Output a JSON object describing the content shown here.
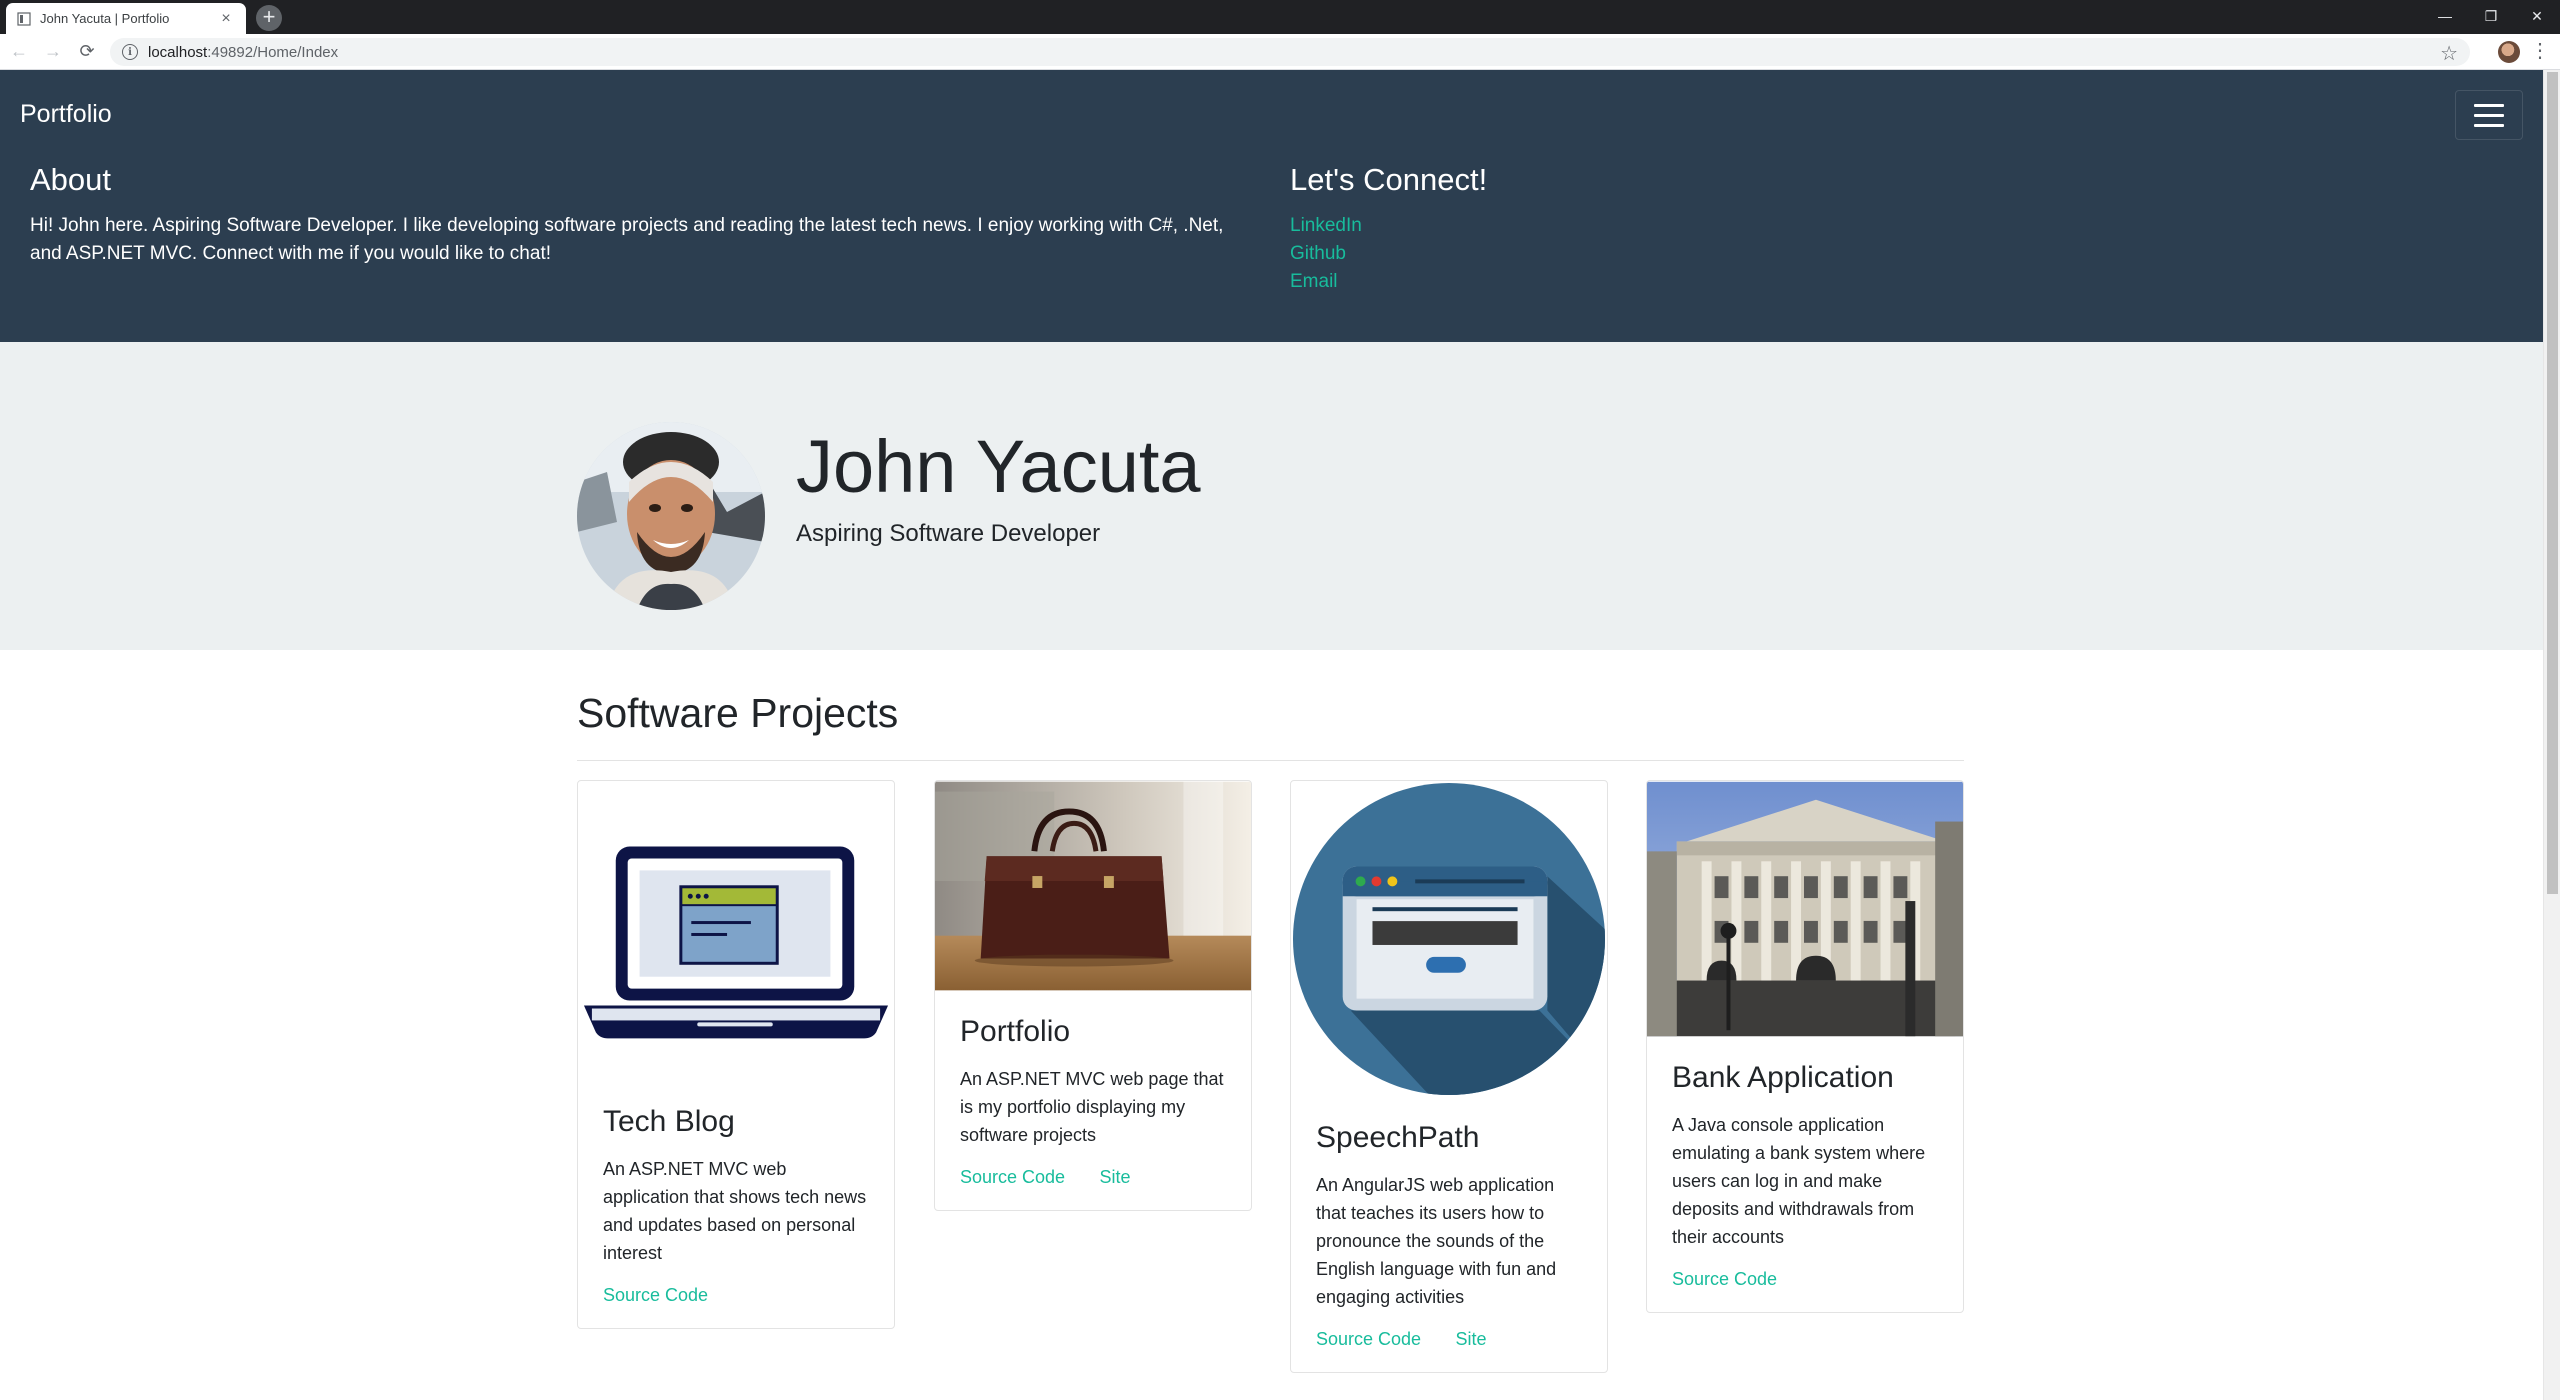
{
  "browser": {
    "tab_title": "John Yacuta | Portfolio",
    "url_host": "localhost",
    "url_rest": ":49892/Home/Index"
  },
  "navbar": {
    "brand": "Portfolio"
  },
  "about": {
    "heading": "About",
    "text": "Hi! John here. Aspiring Software Developer. I like developing software projects and reading the latest tech news. I enjoy working with C#, .Net, and ASP.NET MVC. Connect with me if you would like to chat!"
  },
  "connect": {
    "heading": "Let's Connect!",
    "links": [
      "LinkedIn",
      "Github",
      "Email"
    ]
  },
  "hero": {
    "name": "John Yacuta",
    "subtitle": "Aspiring Software Developer"
  },
  "projects": {
    "heading": "Software Projects",
    "items": [
      {
        "title": "Tech Blog",
        "description": "An ASP.NET MVC web application that shows tech news and updates based on personal interest",
        "links": [
          "Source Code"
        ]
      },
      {
        "title": "Portfolio",
        "description": "An ASP.NET MVC web page that is my portfolio displaying my software projects",
        "links": [
          "Source Code",
          "Site"
        ]
      },
      {
        "title": "SpeechPath",
        "description": "An AngularJS web application that teaches its users how to pronounce the sounds of the English language with fun and engaging activities",
        "links": [
          "Source Code",
          "Site"
        ]
      },
      {
        "title": "Bank Application",
        "description": "A Java console application emulating a bank system where users can log in and make deposits and withdrawals from their accounts",
        "links": [
          "Source Code"
        ]
      }
    ]
  },
  "colors": {
    "navbar_bg": "#2c3e50",
    "accent": "#18bc9c",
    "jumbotron_bg": "#ecf0f1"
  },
  "icons": [
    "page-favicon",
    "new-tab-icon",
    "minimize-icon",
    "restore-icon",
    "close-icon",
    "back-icon",
    "forward-icon",
    "reload-icon",
    "info-icon",
    "bookmark-star-icon",
    "profile-avatar-icon",
    "menu-dots-icon",
    "hamburger-menu-icon"
  ]
}
